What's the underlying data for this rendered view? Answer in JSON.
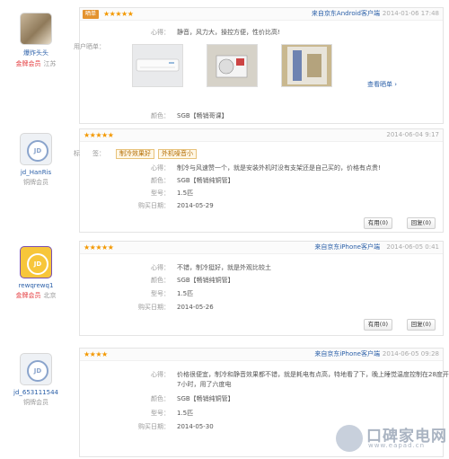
{
  "reviews": [
    {
      "user": {
        "name": "爆炸头头",
        "level": "金牌会员",
        "location": "江苏"
      },
      "badge": "晒单",
      "stars": "★★★★★",
      "source": "来自京东Android客户端",
      "date": "2014-01-06 17:48",
      "experience_label": "心得：",
      "experience": "静音，风力大，操控方便，性价比高!",
      "photos_label": "用户晒单：",
      "see_more": "查看晒单 ›",
      "color_label": "颜色：",
      "color": "SGB【畅销哥课】"
    },
    {
      "user": {
        "name": "jd_HanRis",
        "level": "铜牌会员",
        "location": ""
      },
      "stars": "★★★★★",
      "date": "2014-06-04 9:17",
      "tags_label": "标　　签：",
      "tags": [
        "制冷效果好",
        "外机噪音小"
      ],
      "experience_label": "心得：",
      "experience": "制冷与风速赞一个，就是安装外机时没有支架还是自己买的，价格有点贵!",
      "color_label": "颜色：",
      "color": "SGB【畅销纯铜管】",
      "model_label": "型号：",
      "model": "1.5匹",
      "buy_label": "购买日期：",
      "buy_date": "2014-05-29",
      "useful": "有用(0)",
      "reply": "回复(0)"
    },
    {
      "user": {
        "name": "rewqrewq1",
        "level": "金牌会员",
        "location": "北京"
      },
      "stars": "★★★★★",
      "source": "来自京东iPhone客户端",
      "date": "2014-06-05 0:41",
      "experience_label": "心得：",
      "experience": "不错，制冷挺好，就是外观比较土",
      "color_label": "颜色：",
      "color": "SGB【畅销纯铜管】",
      "model_label": "型号：",
      "model": "1.5匹",
      "buy_label": "购买日期：",
      "buy_date": "2014-05-26",
      "useful": "有用(0)",
      "reply": "回复(0)"
    },
    {
      "user": {
        "name": "jd_653111544",
        "level": "铜牌会员",
        "location": ""
      },
      "stars": "★★★★",
      "source": "来自京东iPhone客户端",
      "date": "2014-06-05 09:28",
      "experience_label": "心得：",
      "experience": "价格很便宜，制冷和静音效果都不错，就是耗电有点高，特地看了下，晚上睡觉温度控制在28度开了",
      "experience2": "7小时，用了六度电",
      "color_label": "颜色：",
      "color": "SGB【畅销纯铜管】",
      "model_label": "型号：",
      "model": "1.5匹",
      "buy_label": "购买日期：",
      "buy_date": "2014-05-30"
    }
  ],
  "watermark": {
    "title": "口碑家电网",
    "url": "www.eapad.cn"
  }
}
